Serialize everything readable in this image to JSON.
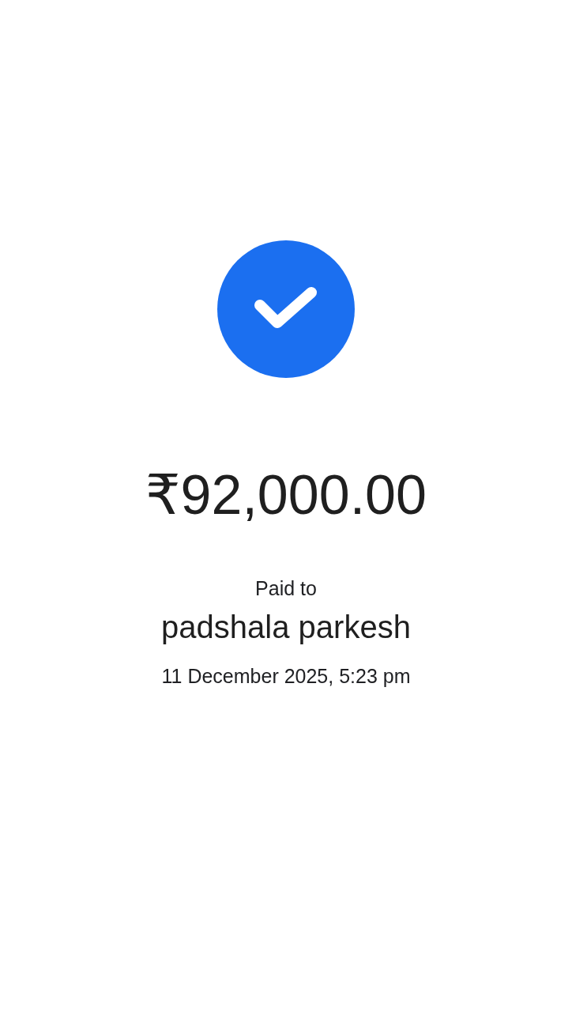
{
  "status": {
    "kind": "success"
  },
  "amount": "₹92,000.00",
  "recipient": {
    "label": "Paid to",
    "name": "padshala parkesh"
  },
  "datetime": "11 December 2025, 5:23 pm"
}
